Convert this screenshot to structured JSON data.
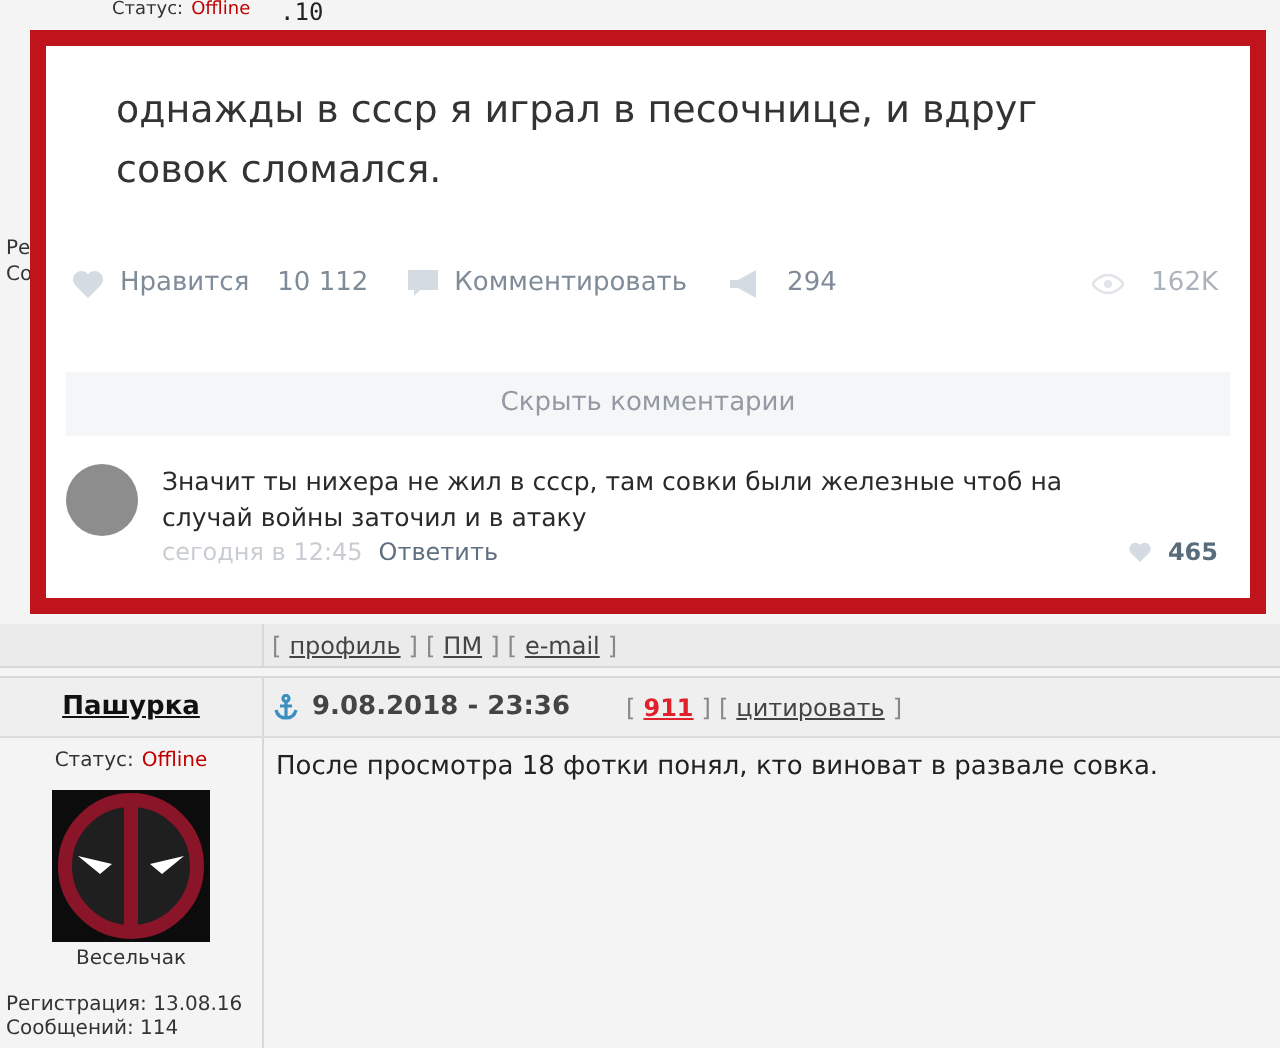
{
  "previous_post": {
    "status_label": "Статус:",
    "status": "Offline",
    "text_fragment": ".10",
    "registration_fragment": "Ре",
    "messages_fragment": "Со",
    "image": {
      "post_text": "однажды в ссср я играл в песочнице, и вдруг совок сломался.",
      "actions": [
        {
          "kind": "like",
          "label": "Нравится",
          "count": "10 112"
        },
        {
          "kind": "comment",
          "label": "Комментировать"
        },
        {
          "kind": "share",
          "count": "294"
        },
        {
          "kind": "views",
          "count": "162K"
        }
      ],
      "hide_comments": "Скрыть комментарии",
      "comment": {
        "text": "Значит ты нихера не жил в ссср, там совки были железные чтоб на случай войны заточил и в атаку",
        "time": "сегодня в 12:45",
        "reply": "Ответить",
        "likes": "465"
      }
    },
    "links": [
      {
        "kind": "bracket",
        "text": "["
      },
      {
        "kind": "link",
        "text": "профиль"
      },
      {
        "kind": "bracket",
        "text": "]"
      },
      {
        "kind": "bracket",
        "text": "["
      },
      {
        "kind": "link",
        "text": "ПМ"
      },
      {
        "kind": "bracket",
        "text": "]"
      },
      {
        "kind": "bracket",
        "text": "["
      },
      {
        "kind": "link",
        "text": "e-mail"
      },
      {
        "kind": "bracket",
        "text": "]"
      }
    ]
  },
  "post": {
    "author": "Пашурка",
    "date": "9.08.2018 - 23:36",
    "meta": [
      {
        "kind": "bracket",
        "text": "["
      },
      {
        "kind": "number",
        "text": "911"
      },
      {
        "kind": "bracket",
        "text": "]"
      },
      {
        "kind": "bracket",
        "text": "["
      },
      {
        "kind": "link",
        "text": "цитировать"
      },
      {
        "kind": "bracket",
        "text": "]"
      }
    ],
    "status_label": "Статус:",
    "status": "Offline",
    "rank": "Весельчак",
    "registration": "Регистрация: 13.08.16",
    "messages": "Сообщений: 114",
    "text": "После просмотра 18 фотки понял, кто виноват в развале совка."
  }
}
